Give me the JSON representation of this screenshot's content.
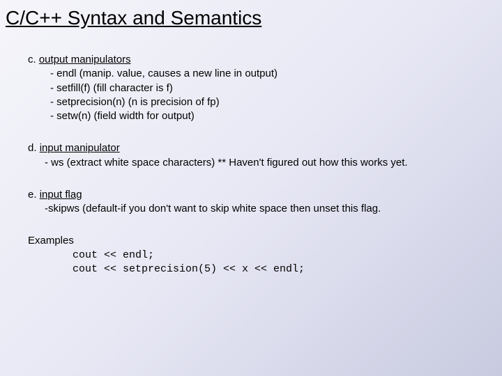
{
  "title": "C/C++ Syntax and Semantics",
  "sections": {
    "c": {
      "prefix": "c. ",
      "heading": "output manipulators",
      "items": [
        "- endl (manip. value, causes a new line in output)",
        "- setfill(f) (fill character is f)",
        "- setprecision(n) (n is precision of fp)",
        "- setw(n) (field width for output)"
      ]
    },
    "d": {
      "prefix": "d. ",
      "heading": "input manipulator",
      "body": "- ws (extract white space characters) ** Haven't figured out how this works yet."
    },
    "e": {
      "prefix": "e. ",
      "heading": "input flag",
      "body": "-skipws (default-if you don't want to skip white space then unset this flag."
    },
    "examples": {
      "label": "Examples",
      "lines": [
        "cout << endl;",
        "cout << setprecision(5) << x << endl;"
      ]
    }
  }
}
